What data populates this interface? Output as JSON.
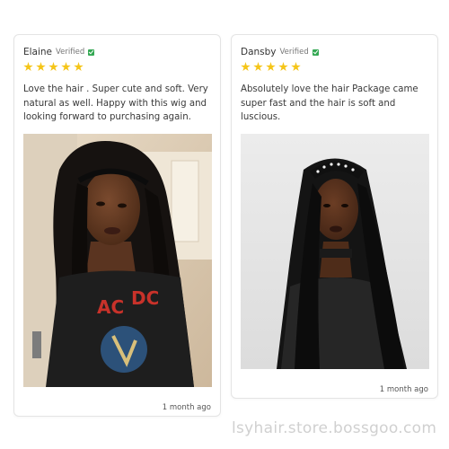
{
  "reviews": [
    {
      "author": "Elaine",
      "verified_label": "Verified",
      "rating": 5,
      "text": "Love the hair . Super cute and soft. Very natural as well. Happy with this wig and looking forward to purchasing again.",
      "date": "1 month ago"
    },
    {
      "author": "Dansby",
      "verified_label": "Verified",
      "rating": 5,
      "text": "Absolutely love the hair Package came super fast and the hair is soft and luscious.",
      "date": "1 month ago"
    }
  ],
  "watermark": "lsyhair.store.bossgoo.com",
  "colors": {
    "star": "#f5c518",
    "verified_check": "#34a853",
    "card_border": "#e4e4e4"
  },
  "icons": {
    "rating": "star-icon",
    "verified": "check-icon"
  }
}
